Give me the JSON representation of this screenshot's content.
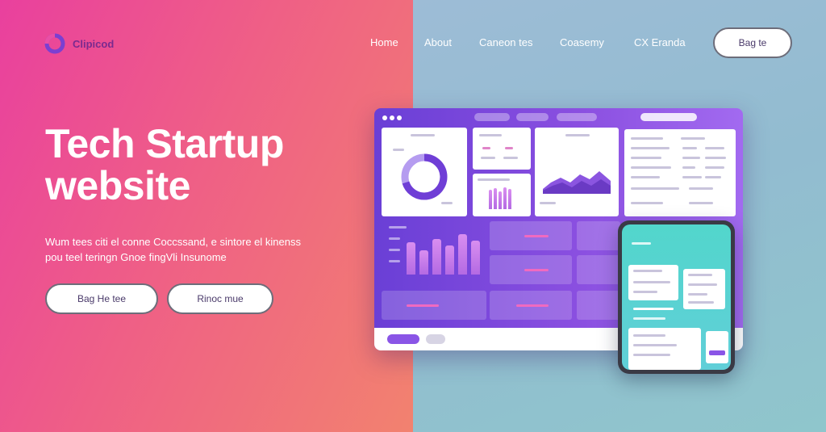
{
  "brand": {
    "logo_text": "Clipicod",
    "logo_color": "#7a2a8f"
  },
  "nav": {
    "items": [
      "Home",
      "About",
      "Caneon tes",
      "Coasemy",
      "CX Eranda"
    ],
    "cta_label": "Bag te"
  },
  "hero": {
    "title_line1": "Tech Startup",
    "title_line2": "website",
    "subtitle_line1": "Wum tees citi el conne Coccssand, e sintore el kinenss",
    "subtitle_line2": "pou teel teringn Gnoe fingVli Insunome",
    "primary_button": "Bag He tee",
    "secondary_button": "Rinoc mue"
  },
  "colors": {
    "left_gradient": [
      "#e9409e",
      "#f2826f"
    ],
    "right_gradient": [
      "#9dbcd6",
      "#8fc6cc"
    ],
    "dashboard_accent": "#8a4fe0",
    "phone_accent": "#52d6cc"
  },
  "icons": {
    "logo": "ring-logo-icon",
    "window_controls": "window-dots-icon",
    "donut": "donut-chart-icon",
    "area": "area-chart-icon",
    "bars": "bar-chart-icon"
  }
}
